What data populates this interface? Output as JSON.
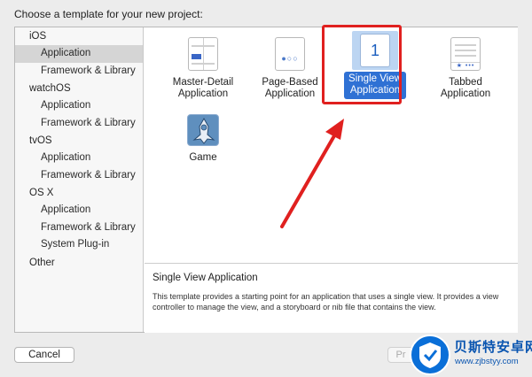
{
  "dialog": {
    "heading": "Choose a template for your new project:"
  },
  "sidebar": {
    "groups": [
      {
        "label": "iOS",
        "items": [
          "Application",
          "Framework & Library"
        ]
      },
      {
        "label": "watchOS",
        "items": [
          "Application",
          "Framework & Library"
        ]
      },
      {
        "label": "tvOS",
        "items": [
          "Application",
          "Framework & Library"
        ]
      },
      {
        "label": "OS X",
        "items": [
          "Application",
          "Framework & Library",
          "System Plug-in"
        ]
      },
      {
        "label": "Other",
        "items": []
      }
    ],
    "selected": "iOS / Application"
  },
  "templates": {
    "master_detail": {
      "line1": "Master-Detail",
      "line2": "Application"
    },
    "page_based": {
      "line1": "Page-Based",
      "line2": "Application",
      "icon_dots": "●○○"
    },
    "single_view": {
      "line1": "Single View",
      "line2": "Application",
      "icon_number": "1",
      "selected": true
    },
    "tabbed": {
      "line1": "Tabbed",
      "line2": "Application",
      "icon_tabs": "★ •••"
    },
    "game": {
      "label": "Game"
    }
  },
  "description": {
    "title": "Single View Application",
    "body": "This template provides a starting point for an application that uses a single view. It provides a view controller to manage the view, and a storyboard or nib file that contains the view."
  },
  "footer": {
    "cancel_label": "Cancel",
    "previous_label": "Pr"
  },
  "watermark": {
    "title": "贝斯特安卓网",
    "url": "www.zjbstyy.com"
  },
  "colors": {
    "highlight_red": "#e0201f",
    "selection_blue": "#2f71d4",
    "tile_highlight": "#bcd5f2"
  }
}
